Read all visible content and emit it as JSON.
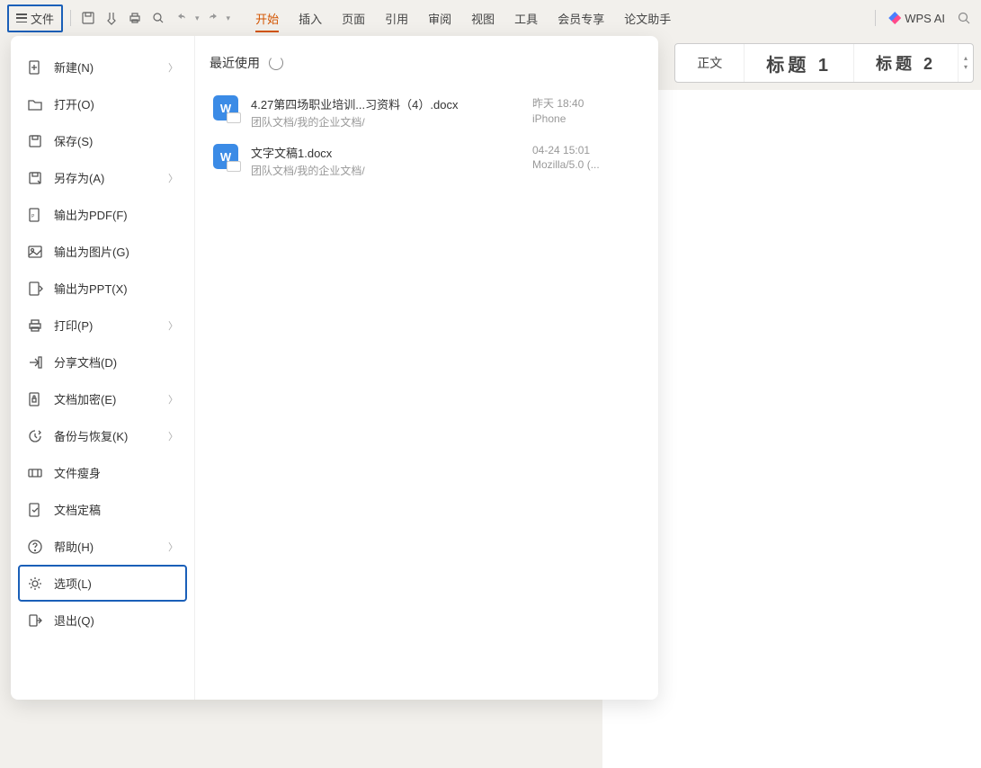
{
  "file_button_label": "文件",
  "tabs": [
    "开始",
    "插入",
    "页面",
    "引用",
    "审阅",
    "视图",
    "工具",
    "会员专享",
    "论文助手"
  ],
  "active_tab_index": 0,
  "wps_ai_label": "WPS AI",
  "styles": {
    "body": "正文",
    "h1": "标题 1",
    "h2": "标题 2"
  },
  "menu": [
    {
      "label": "新建(N)",
      "icon": "plus-page",
      "chev": true
    },
    {
      "label": "打开(O)",
      "icon": "folder",
      "chev": false
    },
    {
      "label": "保存(S)",
      "icon": "save",
      "chev": false
    },
    {
      "label": "另存为(A)",
      "icon": "save-as",
      "chev": true
    },
    {
      "label": "输出为PDF(F)",
      "icon": "pdf",
      "chev": false
    },
    {
      "label": "输出为图片(G)",
      "icon": "image",
      "chev": false
    },
    {
      "label": "输出为PPT(X)",
      "icon": "ppt",
      "chev": false
    },
    {
      "label": "打印(P)",
      "icon": "print",
      "chev": true
    },
    {
      "label": "分享文档(D)",
      "icon": "share",
      "chev": false
    },
    {
      "label": "文档加密(E)",
      "icon": "lock",
      "chev": true
    },
    {
      "label": "备份与恢复(K)",
      "icon": "backup",
      "chev": true
    },
    {
      "label": "文件瘦身",
      "icon": "slim",
      "chev": false
    },
    {
      "label": "文档定稿",
      "icon": "final",
      "chev": false
    },
    {
      "label": "帮助(H)",
      "icon": "help",
      "chev": true
    },
    {
      "label": "选项(L)",
      "icon": "gear",
      "chev": false,
      "highlight": true
    },
    {
      "label": "退出(Q)",
      "icon": "exit",
      "chev": false
    }
  ],
  "recent_header": "最近使用",
  "recent": [
    {
      "title": "4.27第四场职业培训...习资料（4）.docx",
      "path": "团队文档/我的企业文档/",
      "date": "昨天 18:40",
      "source": "iPhone"
    },
    {
      "title": "文字文稿1.docx",
      "path": "团队文档/我的企业文档/",
      "date": "04-24 15:01",
      "source": "Mozilla/5.0 (..."
    }
  ]
}
